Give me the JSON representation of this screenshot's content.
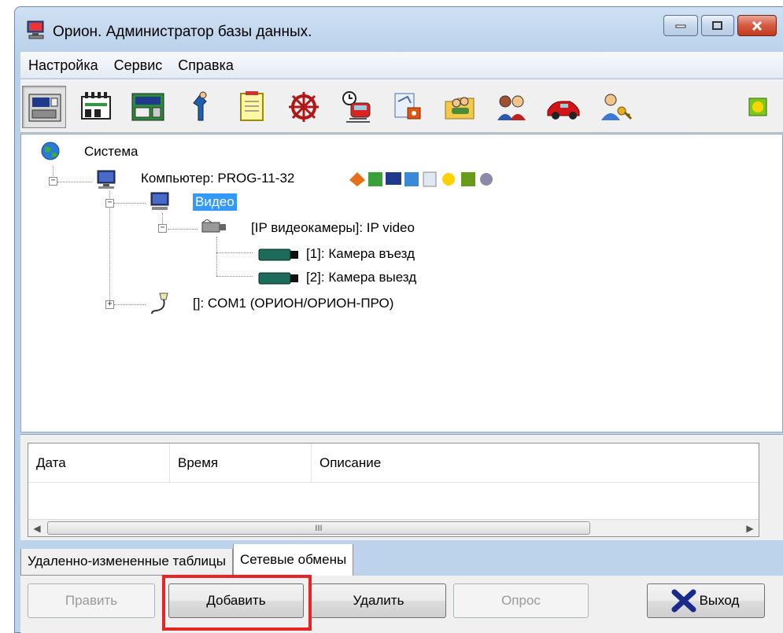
{
  "window": {
    "title": "Орион. Администратор базы данных."
  },
  "menu": {
    "items": [
      "Настройка",
      "Сервис",
      "Справка"
    ]
  },
  "toolbar": {
    "icons": [
      "computer-device-icon",
      "controller-icon",
      "module-icon",
      "operator-icon",
      "notepad-icon",
      "wheel-icon",
      "schedule-train-icon",
      "document-access-icon",
      "users-folder-icon",
      "users-group-icon",
      "car-icon",
      "user-key-icon",
      "sun-icon"
    ]
  },
  "tree": {
    "root": "Система",
    "computer": "Компьютер: PROG-11-32",
    "video": "Видео",
    "ip_cameras": "[IP видеокамеры]: IP video",
    "camera1": "[1]: Камера въезд",
    "camera2": "[2]: Камера выезд",
    "com_port": "[]: COM1 (ОРИОН/ОРИОН-ПРО)"
  },
  "log": {
    "columns": [
      "Дата",
      "Время",
      "Описание"
    ],
    "scroll_grip": "III"
  },
  "tabs": [
    "Удаленно-измененные таблицы",
    "Сетевые обмены"
  ],
  "buttons": {
    "edit": "Править",
    "add": "Добавить",
    "delete": "Удалить",
    "poll": "Опрос",
    "exit": "Выход"
  },
  "colors": {
    "selection": "#3399ff",
    "highlight_box": "#e32626"
  }
}
